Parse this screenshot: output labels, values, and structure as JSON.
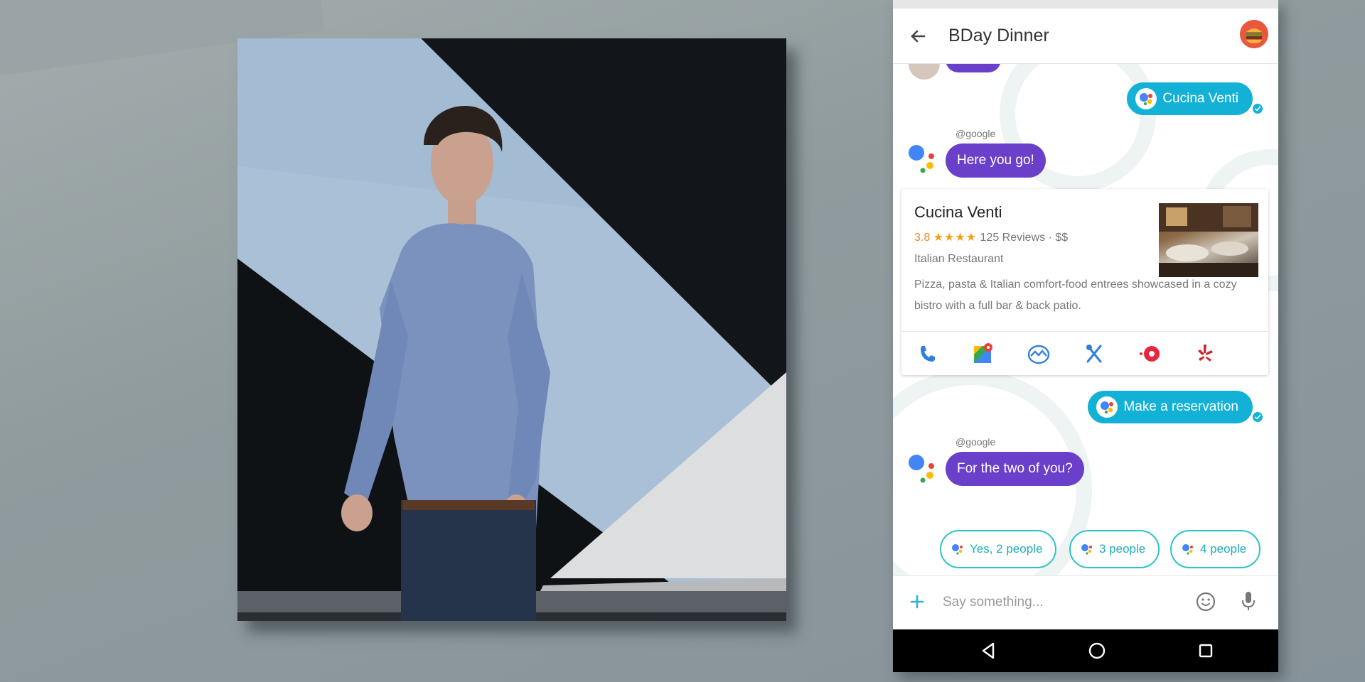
{
  "chat": {
    "title": "BDay Dinner",
    "messages": [
      {
        "type": "outgoing",
        "text": "Cucina Venti"
      },
      {
        "type": "incoming",
        "sender": "@google",
        "text": "Here you go!"
      },
      {
        "type": "outgoing",
        "text": "Make a reservation"
      },
      {
        "type": "incoming",
        "sender": "@google",
        "text": "For the two of you?"
      }
    ],
    "place_card": {
      "name": "Cucina Venti",
      "rating": "3.8",
      "stars": "★★★★",
      "reviews": "125 Reviews · $$",
      "category": "Italian Restaurant",
      "description": "Pizza, pasta & Italian comfort-food entrees showcased in a cozy bistro with a full bar & back patio.",
      "actions": [
        "phone-icon",
        "maps-icon",
        "street-view-icon",
        "menu-icon",
        "booking-icon",
        "yelp-icon"
      ]
    },
    "suggestions": [
      "Yes, 2 people",
      "3 people",
      "4 people"
    ],
    "compose_placeholder": "Say something..."
  },
  "colors": {
    "outgoing_bubble": "#13b1d6",
    "incoming_bubble": "#6a3fc9",
    "suggestion_border": "#2ec3c9"
  }
}
